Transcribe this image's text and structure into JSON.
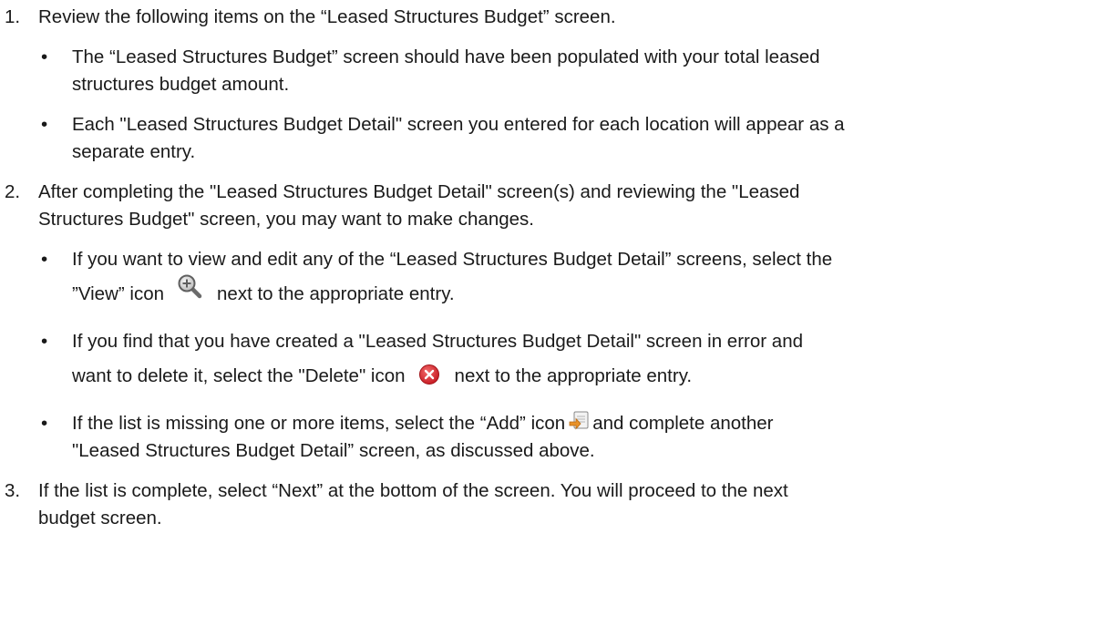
{
  "steps": [
    {
      "num": "1.",
      "text": "Review the following items on the “Leased Structures Budget” screen.",
      "bullets": [
        {
          "lines": [
            "The “Leased Structures Budget” screen should have been populated with your total leased",
            "structures budget amount."
          ]
        },
        {
          "lines": [
            "Each \"Leased Structures Budget Detail\" screen you entered for each location will appear as a",
            "separate entry."
          ]
        }
      ]
    },
    {
      "num": "2.",
      "lines": [
        "After completing the \"Leased Structures Budget Detail\" screen(s) and reviewing the \"Leased",
        "Structures Budget\" screen, you may want to make changes."
      ],
      "bullet_view": {
        "line1": "If you want to view and edit any of the “Leased Structures Budget Detail” screens, select the",
        "before_icon": "”View” icon",
        "after_icon": "next to the appropriate entry.",
        "icon": "zoom-in-icon"
      },
      "bullet_delete": {
        "line1": "If you find that you have created a \"Leased Structures Budget Detail\" screen in error and",
        "before_icon": "want to delete it, select the \"Delete\" icon",
        "after_icon": "next to the appropriate entry.",
        "icon": "delete-icon"
      },
      "bullet_add": {
        "before_icon": "If the list is missing one or more items, select the “Add” icon",
        "after_icon": "and complete another",
        "line2": "\"Leased Structures Budget Detail” screen, as discussed above.",
        "icon": "add-icon"
      }
    },
    {
      "num": "3.",
      "lines": [
        "If the list is complete, select “Next” at the bottom of the screen. You will proceed to the next",
        "budget screen."
      ]
    }
  ],
  "bullet_char": "•",
  "colors": {
    "text": "#1a1a1a",
    "delete_red": "#d0202a",
    "view_gray": "#6b6b6b",
    "add_orange": "#e8922a"
  }
}
